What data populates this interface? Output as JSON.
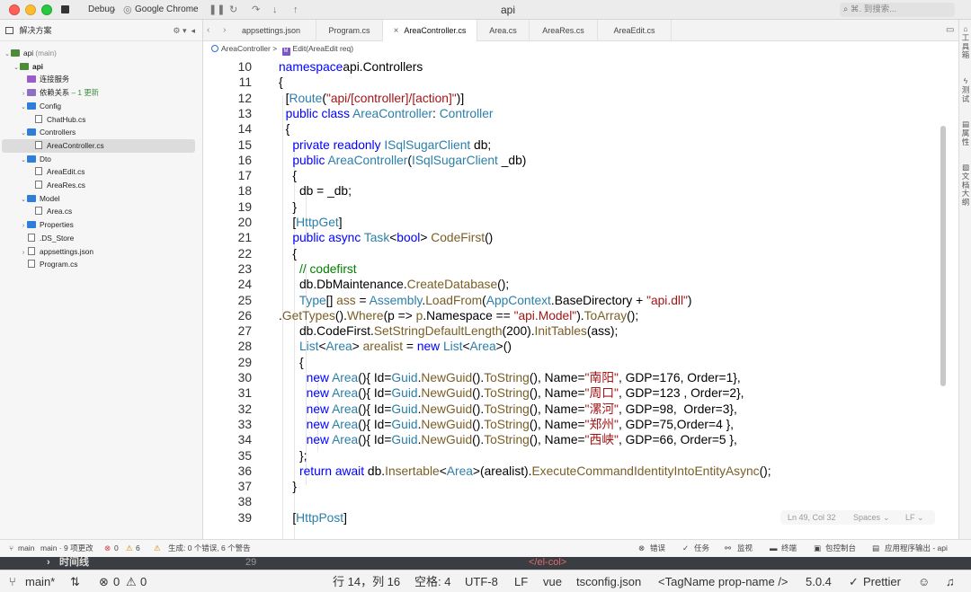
{
  "titlebar": {
    "run_config": "Debug",
    "target": "Google Chrome",
    "title": "api",
    "search_placeholder": "⌘. 到搜索..."
  },
  "sidebar": {
    "title": "解决方案",
    "items": [
      {
        "label": "api",
        "suffix": "(main)"
      },
      {
        "label": "api"
      },
      {
        "label": "连接服务"
      },
      {
        "label": "依赖关系",
        "badge": "– 1 更新"
      },
      {
        "label": "Config"
      },
      {
        "label": "ChatHub.cs"
      },
      {
        "label": "Controllers"
      },
      {
        "label": "AreaController.cs"
      },
      {
        "label": "Dto"
      },
      {
        "label": "AreaEdit.cs"
      },
      {
        "label": "AreaRes.cs"
      },
      {
        "label": "Model"
      },
      {
        "label": "Area.cs"
      },
      {
        "label": "Properties"
      },
      {
        "label": ".DS_Store"
      },
      {
        "label": "appsettings.json"
      },
      {
        "label": "Program.cs"
      }
    ]
  },
  "tabs": [
    {
      "label": "appsettings.json"
    },
    {
      "label": "Program.cs"
    },
    {
      "label": "AreaController.cs",
      "active": true
    },
    {
      "label": "Area.cs"
    },
    {
      "label": "AreaRes.cs"
    },
    {
      "label": "AreaEdit.cs"
    }
  ],
  "breadcrumb": {
    "class_name": "AreaController",
    "separator": ">",
    "method": "Edit(AreaEdit req)"
  },
  "right_toolbar": [
    {
      "label": "工具箱"
    },
    {
      "label": "测试"
    },
    {
      "label": "属性"
    },
    {
      "label": "文档大纲"
    }
  ],
  "editor": {
    "lines": [
      {
        "n": "10",
        "tokens": [
          [
            "kw",
            "namespace"
          ],
          [
            "",
            "api.Controllers"
          ]
        ]
      },
      {
        "n": "11",
        "tokens": [
          [
            "",
            "{"
          ]
        ]
      },
      {
        "n": "12",
        "tokens": [
          [
            "",
            "  ["
          ],
          [
            "ty",
            "Route"
          ],
          [
            "",
            "("
          ],
          [
            "st",
            "\"api/[controller]/[action]\""
          ],
          [
            "",
            ")]"
          ]
        ]
      },
      {
        "n": "13",
        "tokens": [
          [
            "kw",
            "  public class "
          ],
          [
            "ty",
            "AreaController"
          ],
          [
            "",
            ": "
          ],
          [
            "ty",
            "Controller"
          ]
        ]
      },
      {
        "n": "14",
        "tokens": [
          [
            "",
            "  {"
          ]
        ]
      },
      {
        "n": "15",
        "tokens": [
          [
            "kw",
            "    private readonly "
          ],
          [
            "ty",
            "ISqlSugarClient"
          ],
          [
            "",
            " db;"
          ]
        ]
      },
      {
        "n": "16",
        "tokens": [
          [
            "kw",
            "    public "
          ],
          [
            "ty",
            "AreaController"
          ],
          [
            "",
            "("
          ],
          [
            "ty",
            "ISqlSugarClient"
          ],
          [
            "",
            " _db)"
          ]
        ]
      },
      {
        "n": "17",
        "tokens": [
          [
            "",
            "    {"
          ]
        ]
      },
      {
        "n": "18",
        "tokens": [
          [
            "",
            "      db = _db;"
          ]
        ]
      },
      {
        "n": "19",
        "tokens": [
          [
            "",
            "    }"
          ]
        ]
      },
      {
        "n": "20",
        "tokens": [
          [
            "",
            "    ["
          ],
          [
            "ty",
            "HttpGet"
          ],
          [
            "",
            "]"
          ]
        ]
      },
      {
        "n": "21",
        "tokens": [
          [
            "kw",
            "    public async "
          ],
          [
            "ty",
            "Task"
          ],
          [
            "",
            "<"
          ],
          [
            "kw",
            "bool"
          ],
          [
            "",
            "> "
          ],
          [
            "fn",
            "CodeFirst"
          ],
          [
            "",
            "()"
          ]
        ]
      },
      {
        "n": "22",
        "tokens": [
          [
            "",
            "    {"
          ]
        ]
      },
      {
        "n": "23",
        "tokens": [
          [
            "cm",
            "      // codefirst"
          ]
        ]
      },
      {
        "n": "24",
        "tokens": [
          [
            "",
            "      db.DbMaintenance."
          ],
          [
            "fn",
            "CreateDatabase"
          ],
          [
            "",
            "();"
          ]
        ]
      },
      {
        "n": "25",
        "tokens": [
          [
            "ty",
            "      Type"
          ],
          [
            "",
            "[] "
          ],
          [
            "fn",
            "ass"
          ],
          [
            "",
            " = "
          ],
          [
            "ty",
            "Assembly"
          ],
          [
            "",
            "."
          ],
          [
            "fn",
            "LoadFrom"
          ],
          [
            "",
            "("
          ],
          [
            "ty",
            "AppContext"
          ],
          [
            "",
            ".BaseDirectory + "
          ],
          [
            "st",
            "\"api.dll\""
          ],
          [
            "",
            ")"
          ]
        ]
      },
      {
        "n": "26",
        "tokens": [
          [
            "",
            "."
          ],
          [
            "fn",
            "GetTypes"
          ],
          [
            "",
            "()."
          ],
          [
            "fn",
            "Where"
          ],
          [
            "",
            "(p => "
          ],
          [
            "fn",
            "p"
          ],
          [
            "",
            ".Namespace == "
          ],
          [
            "st",
            "\"api.Model\""
          ],
          [
            "",
            ")."
          ],
          [
            "fn",
            "ToArray"
          ],
          [
            "",
            "();"
          ]
        ]
      },
      {
        "n": "27",
        "tokens": [
          [
            "",
            "      db.CodeFirst."
          ],
          [
            "fn",
            "SetStringDefaultLength"
          ],
          [
            "",
            "(200)."
          ],
          [
            "fn",
            "InitTables"
          ],
          [
            "",
            "(ass);"
          ]
        ]
      },
      {
        "n": "28",
        "tokens": [
          [
            "ty",
            "      List"
          ],
          [
            "",
            "<"
          ],
          [
            "ty",
            "Area"
          ],
          [
            "",
            "> "
          ],
          [
            "fn",
            "arealist"
          ],
          [
            "",
            " = "
          ],
          [
            "kw",
            "new "
          ],
          [
            "ty",
            "List"
          ],
          [
            "",
            "<"
          ],
          [
            "ty",
            "Area"
          ],
          [
            "",
            ">()"
          ]
        ]
      },
      {
        "n": "29",
        "tokens": [
          [
            "",
            "      {"
          ]
        ]
      },
      {
        "n": "30",
        "tokens": [
          [
            "kw",
            "        new "
          ],
          [
            "ty",
            "Area"
          ],
          [
            "",
            "(){ Id="
          ],
          [
            "ty",
            "Guid"
          ],
          [
            "",
            "."
          ],
          [
            "fn",
            "NewGuid"
          ],
          [
            "",
            "()."
          ],
          [
            "fn",
            "ToString"
          ],
          [
            "",
            "(), Name="
          ],
          [
            "st",
            "\"南阳\""
          ],
          [
            "",
            ", GDP=176, Order=1},"
          ]
        ]
      },
      {
        "n": "31",
        "tokens": [
          [
            "kw",
            "        new "
          ],
          [
            "ty",
            "Area"
          ],
          [
            "",
            "(){ Id="
          ],
          [
            "ty",
            "Guid"
          ],
          [
            "",
            "."
          ],
          [
            "fn",
            "NewGuid"
          ],
          [
            "",
            "()."
          ],
          [
            "fn",
            "ToString"
          ],
          [
            "",
            "(), Name="
          ],
          [
            "st",
            "\"周口\""
          ],
          [
            "",
            ", GDP=123 , Order=2},"
          ]
        ]
      },
      {
        "n": "32",
        "tokens": [
          [
            "kw",
            "        new "
          ],
          [
            "ty",
            "Area"
          ],
          [
            "",
            "(){ Id="
          ],
          [
            "ty",
            "Guid"
          ],
          [
            "",
            "."
          ],
          [
            "fn",
            "NewGuid"
          ],
          [
            "",
            "()."
          ],
          [
            "fn",
            "ToString"
          ],
          [
            "",
            "(), Name="
          ],
          [
            "st",
            "\"漯河\""
          ],
          [
            "",
            ", GDP=98,  Order=3},"
          ]
        ]
      },
      {
        "n": "33",
        "tokens": [
          [
            "kw",
            "        new "
          ],
          [
            "ty",
            "Area"
          ],
          [
            "",
            "(){ Id="
          ],
          [
            "ty",
            "Guid"
          ],
          [
            "",
            "."
          ],
          [
            "fn",
            "NewGuid"
          ],
          [
            "",
            "()."
          ],
          [
            "fn",
            "ToString"
          ],
          [
            "",
            "(), Name="
          ],
          [
            "st",
            "\"郑州\""
          ],
          [
            "",
            ", GDP=75,Order=4 },"
          ]
        ]
      },
      {
        "n": "34",
        "tokens": [
          [
            "kw",
            "        new "
          ],
          [
            "ty",
            "Area"
          ],
          [
            "",
            "(){ Id="
          ],
          [
            "ty",
            "Guid"
          ],
          [
            "",
            "."
          ],
          [
            "fn",
            "NewGuid"
          ],
          [
            "",
            "()."
          ],
          [
            "fn",
            "ToString"
          ],
          [
            "",
            "(), Name="
          ],
          [
            "st",
            "\"西峡\""
          ],
          [
            "",
            ", GDP=66, Order=5 },"
          ]
        ]
      },
      {
        "n": "35",
        "tokens": [
          [
            "",
            "      };"
          ]
        ]
      },
      {
        "n": "36",
        "tokens": [
          [
            "kw",
            "      return await "
          ],
          [
            "",
            "db."
          ],
          [
            "fn",
            "Insertable"
          ],
          [
            "",
            "<"
          ],
          [
            "ty",
            "Area"
          ],
          [
            "",
            ">(arealist)."
          ],
          [
            "fn",
            "ExecuteCommandIdentityIntoEntityAsync"
          ],
          [
            "",
            "();"
          ]
        ]
      },
      {
        "n": "37",
        "tokens": [
          [
            "",
            "    }"
          ]
        ]
      },
      {
        "n": "38",
        "tokens": []
      },
      {
        "n": "39",
        "tokens": [
          [
            "",
            "    ["
          ],
          [
            "ty",
            "HttpPost"
          ],
          [
            "",
            "]"
          ]
        ]
      }
    ],
    "position": "Ln 49, Col 32",
    "indent": "Spaces",
    "line_ending": "LF"
  },
  "ide_status": {
    "branch": "main",
    "changes": "main · 9 项更改",
    "errors": "0",
    "warnings": "6",
    "build_msg": "生成: 0 个错误, 6 个警告",
    "panels": [
      "错误",
      "任务",
      "监视",
      "终端",
      "包控制台",
      "应用程序输出 - api"
    ]
  },
  "peek": {
    "left_text": "时间线",
    "line_no": "29",
    "right_text": "</el-col>"
  },
  "vscode_status": {
    "branch": "main*",
    "problems_errors": "0",
    "problems_warnings": "0",
    "cursor": "行 14，列 16",
    "spaces": "空格: 4",
    "encoding": "UTF-8",
    "eol": "LF",
    "language": "vue",
    "tsconfig": "tsconfig.json",
    "tagname": "<TagName prop-name />",
    "version": "5.0.4",
    "formatter": "Prettier"
  },
  "colors": {
    "keyword": "#0000ff",
    "type": "#2b7fa8",
    "string": "#a31515",
    "comment": "#008000",
    "method": "#795e26"
  }
}
